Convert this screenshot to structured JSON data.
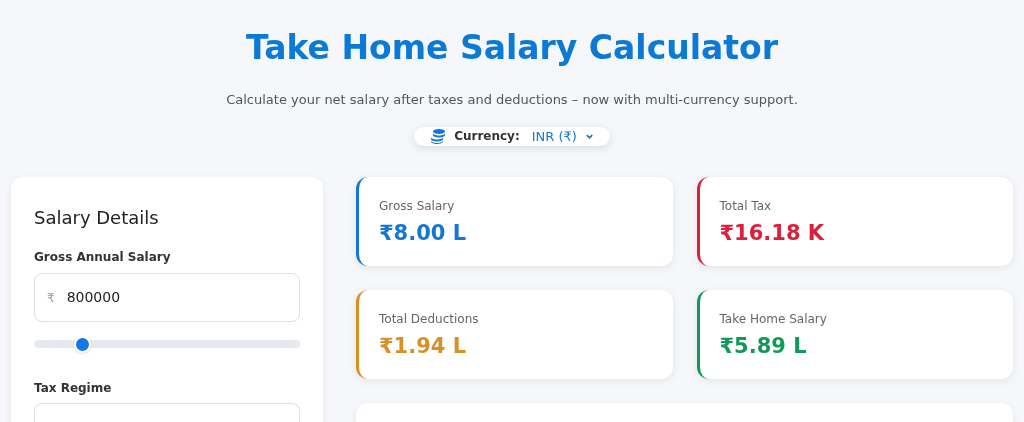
{
  "header": {
    "title": "Take Home Salary Calculator",
    "subtitle": "Calculate your net salary after taxes and deductions – now with multi-currency support."
  },
  "currency": {
    "label": "Currency:",
    "value": "INR (₹)"
  },
  "salary_details": {
    "title": "Salary Details",
    "gross_label": "Gross Annual Salary",
    "gross_prefix": "₹",
    "gross_value": "800000",
    "slider": {
      "level": 0.18
    },
    "tax_regime_label": "Tax Regime"
  },
  "stats": [
    {
      "label": "Gross Salary",
      "value": "₹8.00 L",
      "color": "#1677d2"
    },
    {
      "label": "Total Tax",
      "value": "₹16.18 K",
      "color": "#dc1f3c"
    },
    {
      "label": "Total Deductions",
      "value": "₹1.94 L",
      "color": "#d88f25"
    },
    {
      "label": "Take Home Salary",
      "value": "₹5.89 L",
      "color": "#14985a"
    }
  ]
}
